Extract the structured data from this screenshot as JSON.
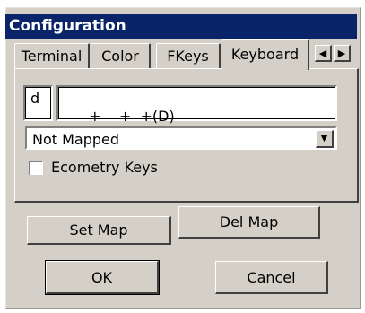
{
  "window": {
    "title": "Configuration"
  },
  "tabs": [
    {
      "label": "Terminal"
    },
    {
      "label": "Color"
    },
    {
      "label": "FKeys"
    },
    {
      "label": "Keyboard",
      "selected": true
    }
  ],
  "tab_scroll": {
    "left_icon": "arrow-left-icon",
    "right_icon": "arrow-right-icon",
    "left_glyph": "◀",
    "right_glyph": "▶"
  },
  "keyboard": {
    "key_char": "d",
    "key_combo": "+    +  +(D)",
    "mapping_value": "Not Mapped",
    "ecometry_keys_label": "Ecometry Keys",
    "ecometry_keys_checked": false,
    "combo_arrow_glyph": "▼"
  },
  "buttons": {
    "set_map": "Set Map",
    "del_map": "Del Map",
    "ok": "OK",
    "cancel": "Cancel"
  },
  "colors": {
    "titlebar": "#0a246a",
    "face": "#d4d0c8"
  }
}
